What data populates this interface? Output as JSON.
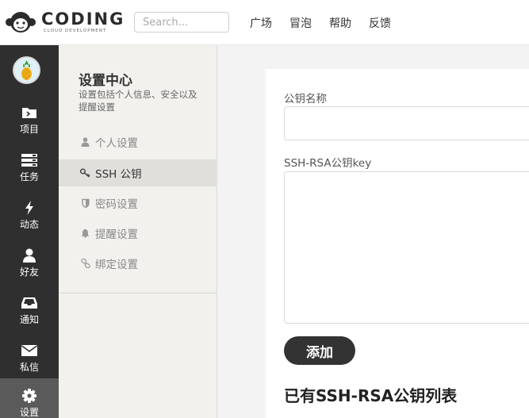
{
  "header": {
    "logo_text": "CODING",
    "logo_sub": "CLOUD DEVELOPMENT",
    "search_placeholder": "Search...",
    "nav": [
      "广场",
      "冒泡",
      "帮助",
      "反馈"
    ]
  },
  "sidebar": {
    "items": [
      {
        "label": "项目",
        "icon": "folder-icon"
      },
      {
        "label": "任务",
        "icon": "tasks-icon"
      },
      {
        "label": "动态",
        "icon": "bolt-icon"
      },
      {
        "label": "好友",
        "icon": "user-icon"
      },
      {
        "label": "通知",
        "icon": "inbox-icon"
      },
      {
        "label": "私信",
        "icon": "envelope-icon"
      },
      {
        "label": "设置",
        "icon": "gear-icon",
        "active": true
      }
    ]
  },
  "settings_menu": {
    "title": "设置中心",
    "description": "设置包括个人信息、安全以及提醒设置",
    "items": [
      {
        "label": "个人设置",
        "icon": "user-icon"
      },
      {
        "label": "SSH 公钥",
        "icon": "key-icon",
        "active": true
      },
      {
        "label": "密码设置",
        "icon": "shield-icon"
      },
      {
        "label": "提醒设置",
        "icon": "bell-icon"
      },
      {
        "label": "绑定设置",
        "icon": "link-icon"
      }
    ]
  },
  "form": {
    "name_label": "公钥名称",
    "name_value": "",
    "key_label": "SSH-RSA公钥key",
    "key_value": "",
    "add_button": "添加",
    "list_title": "已有SSH-RSA公钥列表"
  },
  "colors": {
    "sidebar_bg": "#2f2f2f",
    "sidebar_active": "#5a5a5a",
    "menu_bg": "#f2f1ed",
    "menu_active": "#e0dfdb",
    "button_bg": "#333333"
  }
}
